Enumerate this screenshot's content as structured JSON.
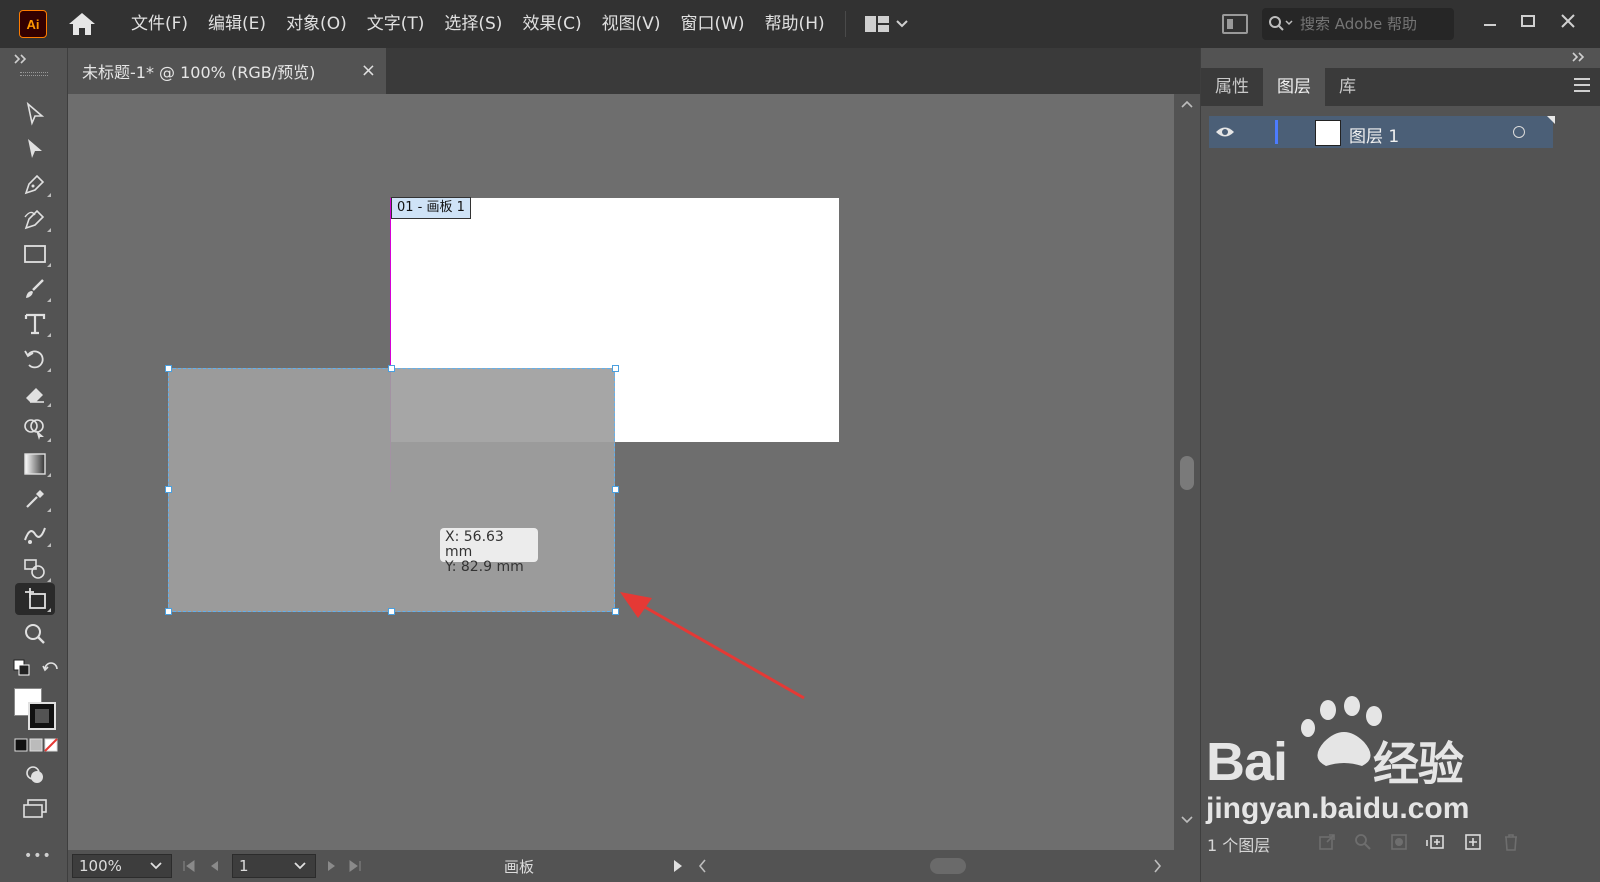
{
  "app": {
    "logo_text": "Ai"
  },
  "menu": {
    "items": [
      {
        "label": "文件(F)"
      },
      {
        "label": "编辑(E)"
      },
      {
        "label": "对象(O)"
      },
      {
        "label": "文字(T)"
      },
      {
        "label": "选择(S)"
      },
      {
        "label": "效果(C)"
      },
      {
        "label": "视图(V)"
      },
      {
        "label": "窗口(W)"
      },
      {
        "label": "帮助(H)"
      }
    ]
  },
  "search": {
    "placeholder": "搜索 Adobe 帮助"
  },
  "document": {
    "tab_title": "未标题-1* @ 100% (RGB/预览)",
    "close_glyph": "×"
  },
  "artboard": {
    "label": "01 - 画板 1"
  },
  "coordinates": {
    "x_text": "X: 56.63 mm",
    "y_text": "Y: 82.9 mm"
  },
  "statusbar": {
    "zoom": "100%",
    "page": "1",
    "tool_name": "画板"
  },
  "panel": {
    "tabs": [
      {
        "label": "属性",
        "active": false
      },
      {
        "label": "图层",
        "active": true
      },
      {
        "label": "库",
        "active": false
      }
    ],
    "layer": {
      "name": "图层 1",
      "color": "#4c7cff"
    },
    "footer_text": "1 个图层"
  },
  "watermark": {
    "brand": "Bai",
    "brand_cn": "经验",
    "url": "jingyan.baidu.com"
  },
  "colors": {
    "arrow": "#e53935",
    "selection": "#5fb0f0",
    "accent_logo": "#ff9a00"
  }
}
